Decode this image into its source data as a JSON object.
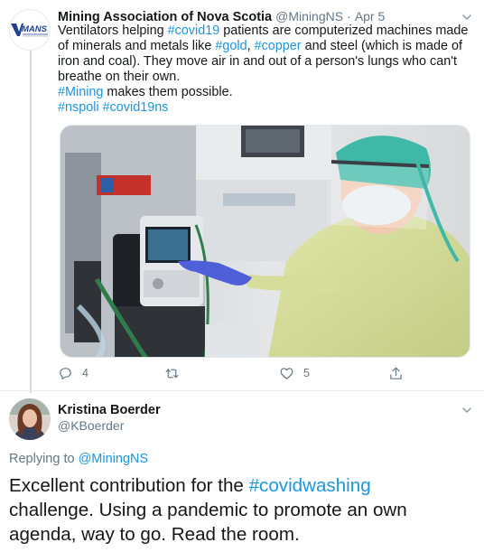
{
  "tweet": {
    "author": {
      "name": "Mining Association of Nova Scotia",
      "handle": "@MiningNS",
      "separator": "·",
      "date": "Apr 5",
      "logo_text": "MANS"
    },
    "text": {
      "line1_a": "Ventilators helping ",
      "tag_covid19": "#covid19",
      "line1_b": " patients are computerized machines made of minerals and metals like ",
      "tag_gold": "#gold",
      "comma": ", ",
      "tag_copper": "#copper",
      "line1_c": " and steel (which is made of iron and coal). They move air in and out of a person's lungs who can't breathe on their own.",
      "tag_mining": "#Mining",
      "line2_b": " makes them possible.",
      "tag_nspoli": "#nspoli",
      "space": " ",
      "tag_covid19ns": "#covid19ns"
    },
    "actions": {
      "reply_count": "4",
      "retweet_count": "",
      "like_count": "5"
    }
  },
  "reply": {
    "author": {
      "name": "Kristina Boerder",
      "handle": "@KBoerder"
    },
    "replying_prefix": "Replying to ",
    "replying_handle": "@MiningNS",
    "text_a": "Excellent contribution for the ",
    "tag_covidwashing": "#covidwashing",
    "text_b": " challenge. Using a pandemic to promote an own agenda, way to go. Read the room."
  },
  "colors": {
    "link": "#1b95e0",
    "secondary_text": "#657786",
    "primary_text": "#14171a",
    "logo_blue": "#1f3f8f"
  },
  "icons": {
    "reply": "reply-icon",
    "retweet": "retweet-icon",
    "like": "heart-icon",
    "share": "share-icon",
    "more": "chevron-down-icon"
  }
}
